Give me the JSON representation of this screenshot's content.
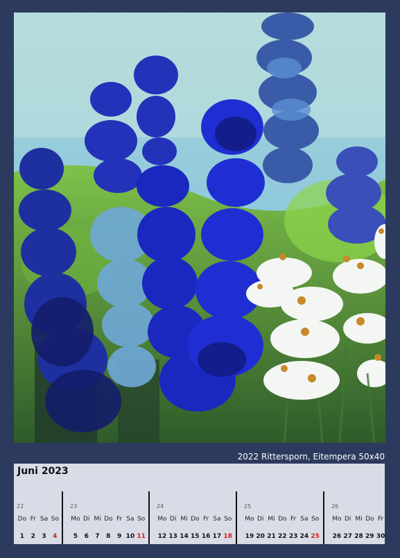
{
  "artwork": {
    "caption": "2022 Rittersporn, Eitempera 50x40",
    "description_icon": "painting-blue-delphinium-white-daisies"
  },
  "calendar": {
    "month_title": "Juni 2023",
    "accent_sunday_color": "#d3201a",
    "weeks": [
      {
        "week_number": "22",
        "days": [
          "Do",
          "Fr",
          "Sa",
          "So"
        ],
        "dates": [
          "1",
          "2",
          "3",
          "4"
        ],
        "sunday_index": 3
      },
      {
        "week_number": "23",
        "days": [
          "Mo",
          "Di",
          "Mi",
          "Do",
          "Fr",
          "Sa",
          "So"
        ],
        "dates": [
          "5",
          "6",
          "7",
          "8",
          "9",
          "10",
          "11"
        ],
        "sunday_index": 6
      },
      {
        "week_number": "24",
        "days": [
          "Mo",
          "Di",
          "Mi",
          "Do",
          "Fr",
          "Sa",
          "So"
        ],
        "dates": [
          "12",
          "13",
          "14",
          "15",
          "16",
          "17",
          "18"
        ],
        "sunday_index": 6
      },
      {
        "week_number": "25",
        "days": [
          "Mo",
          "Di",
          "Mi",
          "Do",
          "Fr",
          "Sa",
          "So"
        ],
        "dates": [
          "19",
          "20",
          "21",
          "22",
          "23",
          "24",
          "25"
        ],
        "sunday_index": 6
      },
      {
        "week_number": "26",
        "days": [
          "Mo",
          "Di",
          "Mi",
          "Do",
          "Fr"
        ],
        "dates": [
          "26",
          "27",
          "28",
          "29",
          "30"
        ],
        "sunday_index": -1
      }
    ]
  }
}
